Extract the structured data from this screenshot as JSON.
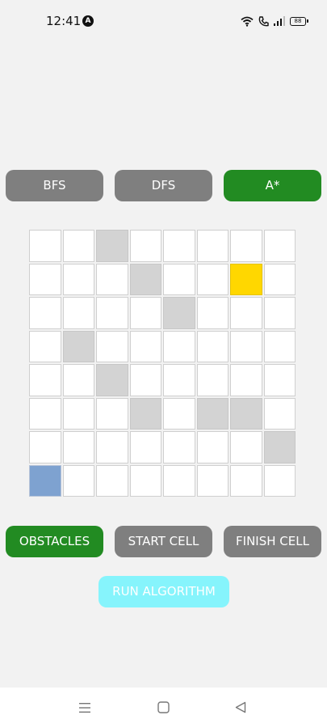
{
  "status": {
    "time": "12:41",
    "badge": "A",
    "battery": "88"
  },
  "algorithms": [
    {
      "label": "BFS",
      "selected": false
    },
    {
      "label": "DFS",
      "selected": false
    },
    {
      "label": "A*",
      "selected": true
    }
  ],
  "grid": {
    "rows": 8,
    "cols": 8,
    "obstacles": [
      [
        0,
        2
      ],
      [
        1,
        3
      ],
      [
        2,
        4
      ],
      [
        3,
        1
      ],
      [
        4,
        2
      ],
      [
        5,
        3
      ],
      [
        5,
        5
      ],
      [
        5,
        6
      ],
      [
        6,
        7
      ]
    ],
    "start": [
      7,
      0
    ],
    "finish": [
      1,
      6
    ]
  },
  "modes": [
    {
      "label": "OBSTACLES",
      "selected": true
    },
    {
      "label": "START CELL",
      "selected": false
    },
    {
      "label": "FINISH CELL",
      "selected": false
    }
  ],
  "run_label": "RUN ALGORITHM",
  "colors": {
    "selected": "#228b22",
    "unselected": "#7f7f7f",
    "obstacle": "#d3d3d3",
    "start": "#7ea2d0",
    "finish": "#ffd700",
    "run": "#86f4fc"
  },
  "nav": {
    "menu_icon": "menu-icon",
    "home_icon": "home-icon",
    "back_icon": "back-icon"
  }
}
